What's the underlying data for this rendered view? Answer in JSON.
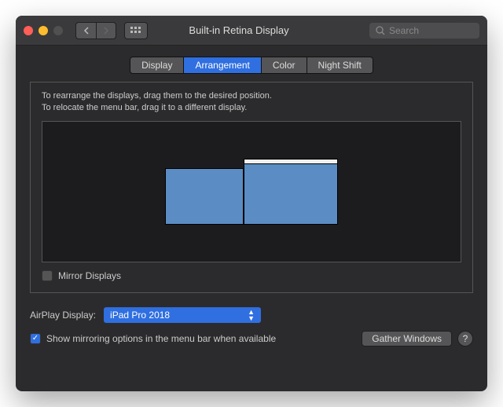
{
  "window": {
    "title": "Built-in Retina Display",
    "search_placeholder": "Search"
  },
  "tabs": {
    "items": [
      {
        "label": "Display"
      },
      {
        "label": "Arrangement"
      },
      {
        "label": "Color"
      },
      {
        "label": "Night Shift"
      }
    ]
  },
  "arrangement": {
    "instruction1": "To rearrange the displays, drag them to the desired position.",
    "instruction2": "To relocate the menu bar, drag it to a different display.",
    "mirror_label": "Mirror Displays"
  },
  "airplay": {
    "label": "AirPlay Display:",
    "selected": "iPad Pro 2018"
  },
  "options": {
    "show_mirroring_label": "Show mirroring options in the menu bar when available",
    "gather_windows_label": "Gather Windows",
    "help_label": "?"
  }
}
